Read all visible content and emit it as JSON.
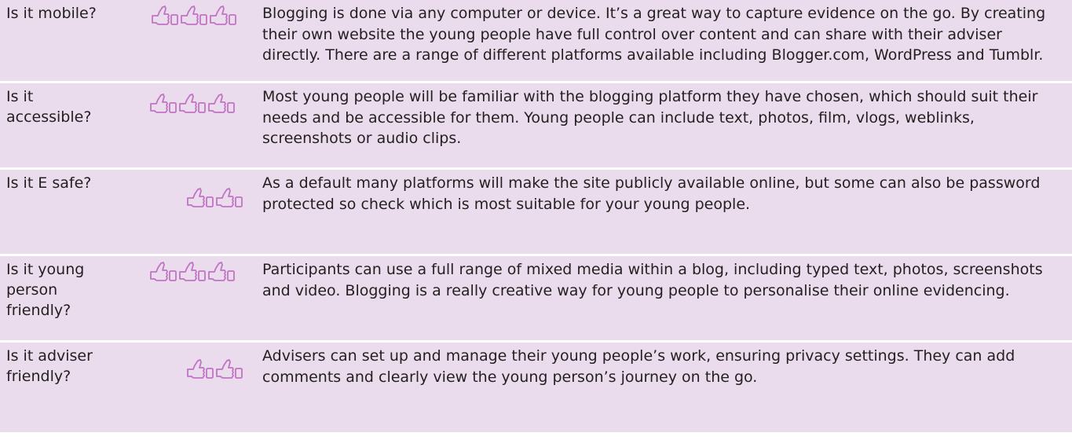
{
  "rows": [
    {
      "question": "Is it mobile?",
      "rating": 3,
      "answer": "Blogging is done via any computer or device. It’s a great way to capture evidence on the go. By creating their own website the young people have full control over content and can share with their adviser directly. There are a range of different platforms available  including Blogger.com, WordPress and Tumblr."
    },
    {
      "question": "Is it accessible?",
      "rating": 3,
      "answer": "Most young people will be familiar with the blogging platform they have chosen, which should suit their needs and be accessible for them.  Young people can include text, photos, film, vlogs, weblinks, screenshots or audio clips."
    },
    {
      "question": "Is it E safe?",
      "rating": 2,
      "answer": "As a default many platforms will make the site publicly available online, but some can also be password protected so check which is most suitable for your young people."
    },
    {
      "question": "Is it young person friendly?",
      "rating": 3,
      "answer": "Participants can use a full range of mixed media within a blog, including typed text, photos, screenshots and video.  Blogging is a really creative way for young people to personalise their online evidencing."
    },
    {
      "question": "Is it adviser friendly?",
      "rating": 2,
      "answer": "Advisers can set up and manage their young people’s work, ensuring privacy settings. They can add comments and clearly view the young person’s journey on the go."
    }
  ],
  "icons": {
    "thumb": "thumbs-up-icon",
    "color": "#c173c4"
  },
  "colors": {
    "row_background": "#eadcec"
  }
}
